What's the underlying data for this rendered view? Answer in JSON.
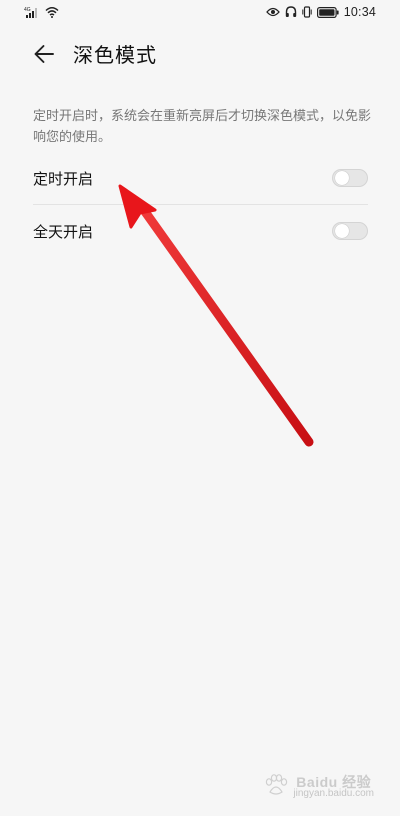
{
  "status_bar": {
    "network": "4G",
    "time": "10:34"
  },
  "header": {
    "title": "深色模式",
    "back_icon": "arrow-left-icon"
  },
  "description": "定时开启时，系统会在重新亮屏后才切换深色模式，以免影响您的使用。",
  "settings": [
    {
      "label": "定时开启",
      "enabled": false
    },
    {
      "label": "全天开启",
      "enabled": false
    }
  ],
  "annotation": {
    "color": "#e8161b"
  },
  "watermark": {
    "brand": "Baidu 经验",
    "url": "jingyan.baidu.com"
  }
}
